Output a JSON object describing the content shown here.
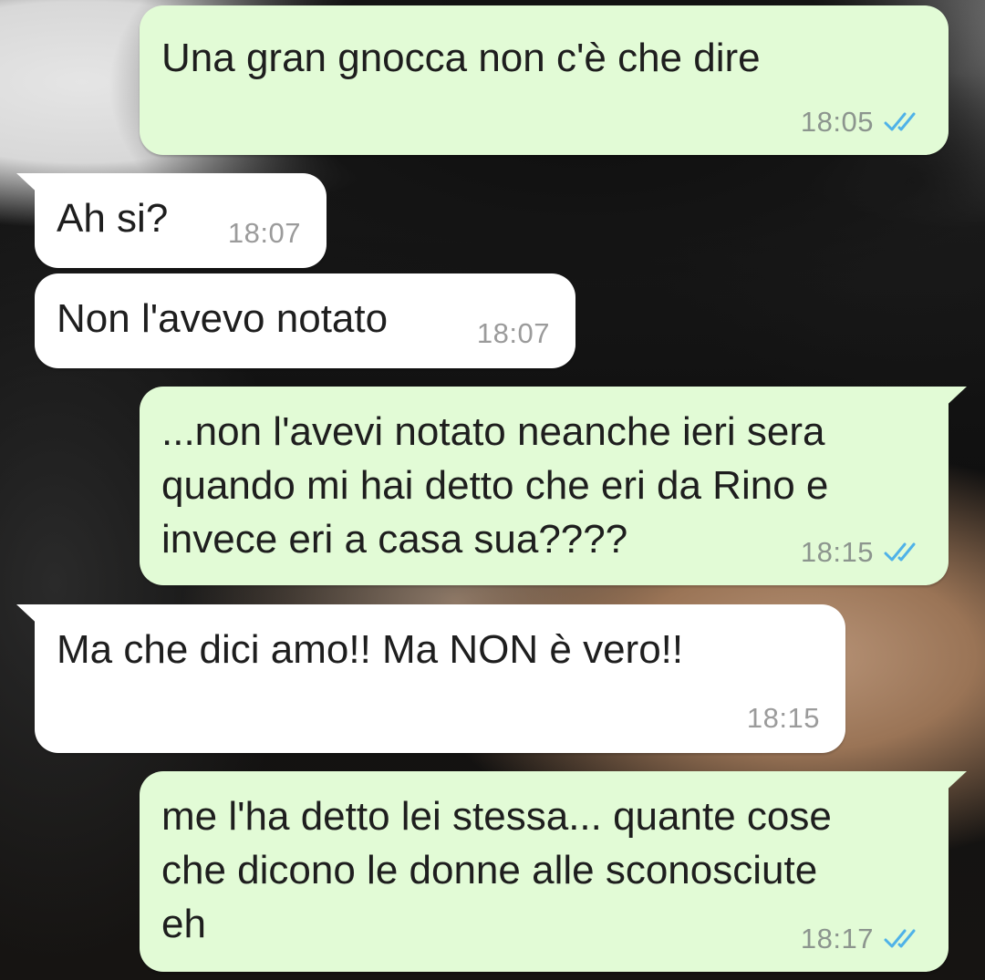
{
  "conversation": {
    "messages": [
      {
        "direction": "outgoing",
        "text": "Una gran gnocca non c'è che dire",
        "time": "18:05",
        "status": "read"
      },
      {
        "direction": "incoming",
        "text": "Ah si?",
        "time": "18:07"
      },
      {
        "direction": "incoming",
        "text": "Non l'avevo notato",
        "time": "18:07"
      },
      {
        "direction": "outgoing",
        "text": "...non l'avevi notato neanche ieri sera\nquando mi hai detto che eri da Rino e\ninvece eri a casa sua????",
        "time": "18:15",
        "status": "read"
      },
      {
        "direction": "incoming",
        "text": "Ma che dici amo!! Ma NON è vero!!",
        "time": "18:15"
      },
      {
        "direction": "outgoing",
        "text": "me l'ha detto lei stessa... quante cose\nche dicono le donne alle sconosciute\neh",
        "time": "18:17",
        "status": "read"
      }
    ]
  },
  "theme": {
    "outgoing_bubble": "#e2fbd6",
    "incoming_bubble": "#ffffff",
    "read_ticks": "#4fb2e8",
    "timestamp": "#8c958e"
  },
  "icons": {
    "read_receipt": "double-check-icon"
  }
}
